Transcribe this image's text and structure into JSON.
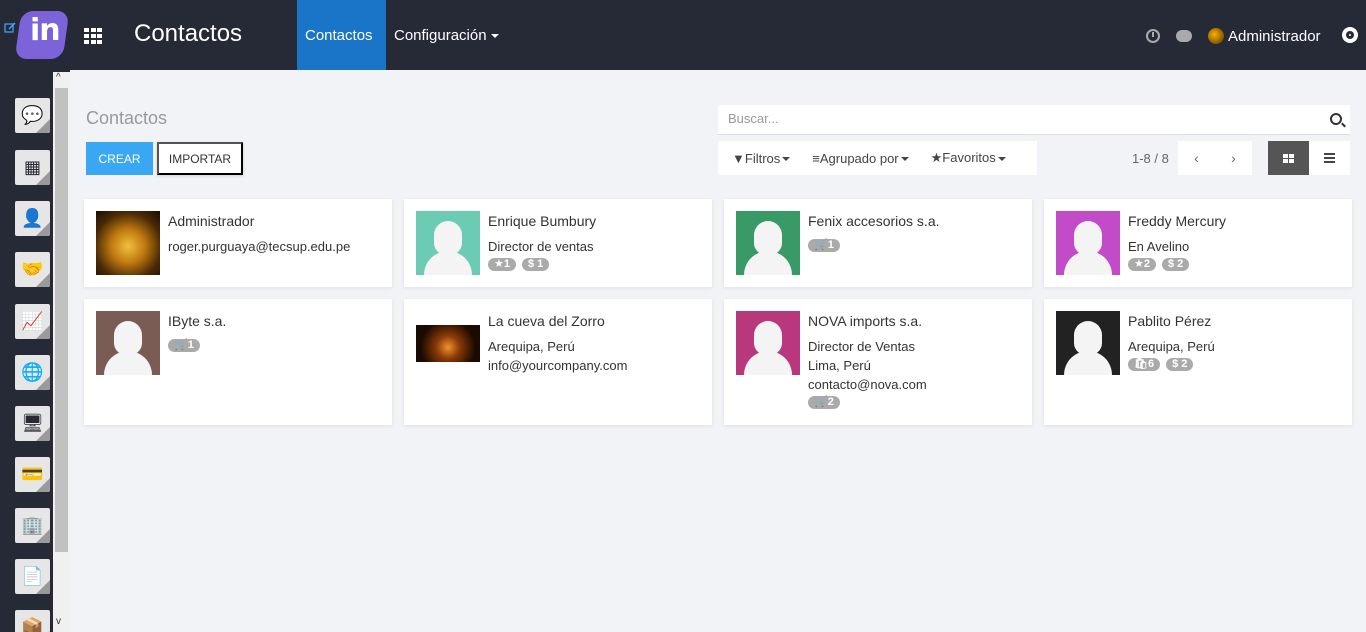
{
  "header": {
    "logo_text": "in",
    "app_title": "Contactos",
    "nav": [
      {
        "label": "Contactos",
        "active": true
      },
      {
        "label": "Configuración",
        "active": false
      }
    ],
    "user_name": "Administrador"
  },
  "sidebar": {
    "items": [
      {
        "icon": "chat-bubbles-icon",
        "glyph": "💬"
      },
      {
        "icon": "calendar-icon",
        "glyph": "▦"
      },
      {
        "icon": "contacts-icon",
        "glyph": "👤"
      },
      {
        "icon": "handshake-icon",
        "glyph": "🤝"
      },
      {
        "icon": "chart-line-icon",
        "glyph": "📈"
      },
      {
        "icon": "globe-icon",
        "glyph": "🌐"
      },
      {
        "icon": "monitor-icon",
        "glyph": "🖥"
      },
      {
        "icon": "credit-card-icon",
        "glyph": "💳"
      },
      {
        "icon": "building-icon",
        "glyph": "🏢"
      },
      {
        "icon": "document-icon",
        "glyph": "📄"
      },
      {
        "icon": "boxes-icon",
        "glyph": "📦"
      }
    ]
  },
  "control": {
    "breadcrumb": "Contactos",
    "create_label": "CREAR",
    "import_label": "IMPORTAR",
    "search_placeholder": "Buscar...",
    "filters_label": "Filtros",
    "groupby_label": "Agrupado por",
    "favorites_label": "Favoritos",
    "pager": "1-8 / 8"
  },
  "colors": {
    "topbar": "#262a36",
    "accent": "#1a74c7",
    "create_button": "#3aa7f5"
  },
  "cards": [
    {
      "name": "Administrador",
      "lines": [
        "roger.purguaya@tecsup.edu.pe"
      ],
      "badges": [],
      "avatar": "photo-puss",
      "color": "#8a5a1a"
    },
    {
      "name": "Enrique Bumbury",
      "lines": [
        "Director de ventas"
      ],
      "badges": [
        "★1",
        "$ 1"
      ],
      "avatar": "placeholder",
      "color": "#6bcbb3"
    },
    {
      "name": "Fenix accesorios s.a.",
      "lines": [],
      "badges": [
        "🛒1"
      ],
      "avatar": "placeholder",
      "color": "#3a9a67"
    },
    {
      "name": "Freddy Mercury",
      "lines": [
        "En Avelino"
      ],
      "badges": [
        "★2",
        "$ 2"
      ],
      "avatar": "placeholder",
      "color": "#c24bc7"
    },
    {
      "name": "IByte s.a.",
      "lines": [],
      "badges": [
        "🛒1"
      ],
      "avatar": "placeholder",
      "color": "#7a5c55"
    },
    {
      "name": "La cueva del Zorro",
      "lines": [
        "Arequipa, Perú",
        "info@yourcompany.com"
      ],
      "badges": [],
      "avatar": "photo-zorro",
      "color": "#2a1608"
    },
    {
      "name": "NOVA imports s.a.",
      "lines": [
        "Director de Ventas",
        "Lima, Perú",
        "contacto@nova.com"
      ],
      "badges": [
        "🛒2"
      ],
      "avatar": "placeholder",
      "color": "#b8377d"
    },
    {
      "name": "Pablito Pérez",
      "lines": [
        "Arequipa, Perú"
      ],
      "badges": [
        "🛍6",
        "$ 2"
      ],
      "avatar": "placeholder",
      "color": "#222222"
    }
  ]
}
